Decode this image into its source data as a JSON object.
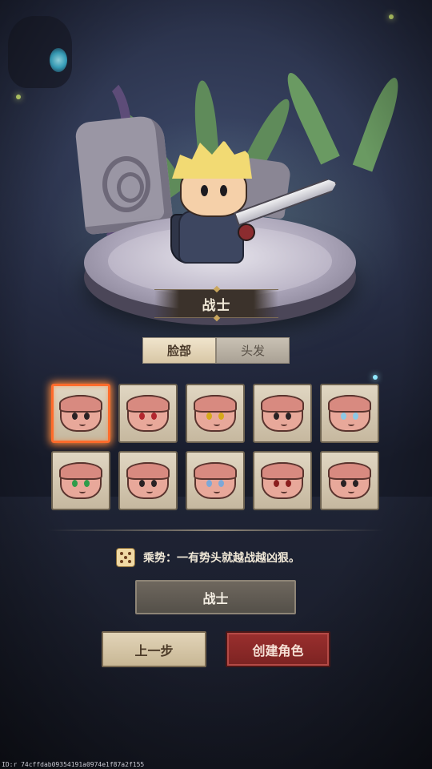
{
  "character": {
    "class_title": "战士"
  },
  "tabs": [
    {
      "label": "脸部",
      "active": true
    },
    {
      "label": "头发",
      "active": false
    }
  ],
  "faces": {
    "selected_index": 0,
    "items": [
      {
        "eye_color": "#2a2224"
      },
      {
        "eye_color": "#b2262e"
      },
      {
        "eye_color": "#d6a91a"
      },
      {
        "eye_color": "#2a2224"
      },
      {
        "eye_color": "#8cc8e6"
      },
      {
        "eye_color": "#2f9c4a"
      },
      {
        "eye_color": "#2a2224"
      },
      {
        "eye_color": "#7ca8d8"
      },
      {
        "eye_color": "#8b1e1e"
      },
      {
        "eye_color": "#2a2224"
      }
    ]
  },
  "trait": {
    "text": "乘势：一有势头就越战越凶狠。",
    "icon": "dice-icon"
  },
  "class_button": {
    "label": "战士"
  },
  "buttons": {
    "prev_label": "上一步",
    "create_label": "创建角色"
  },
  "footer": {
    "id_text": "ID:r 74cffdab09354191a0974e1f87a2f155"
  },
  "colors": {
    "selected_border": "#ff6b2b",
    "create_button": "#9a2f2e"
  }
}
